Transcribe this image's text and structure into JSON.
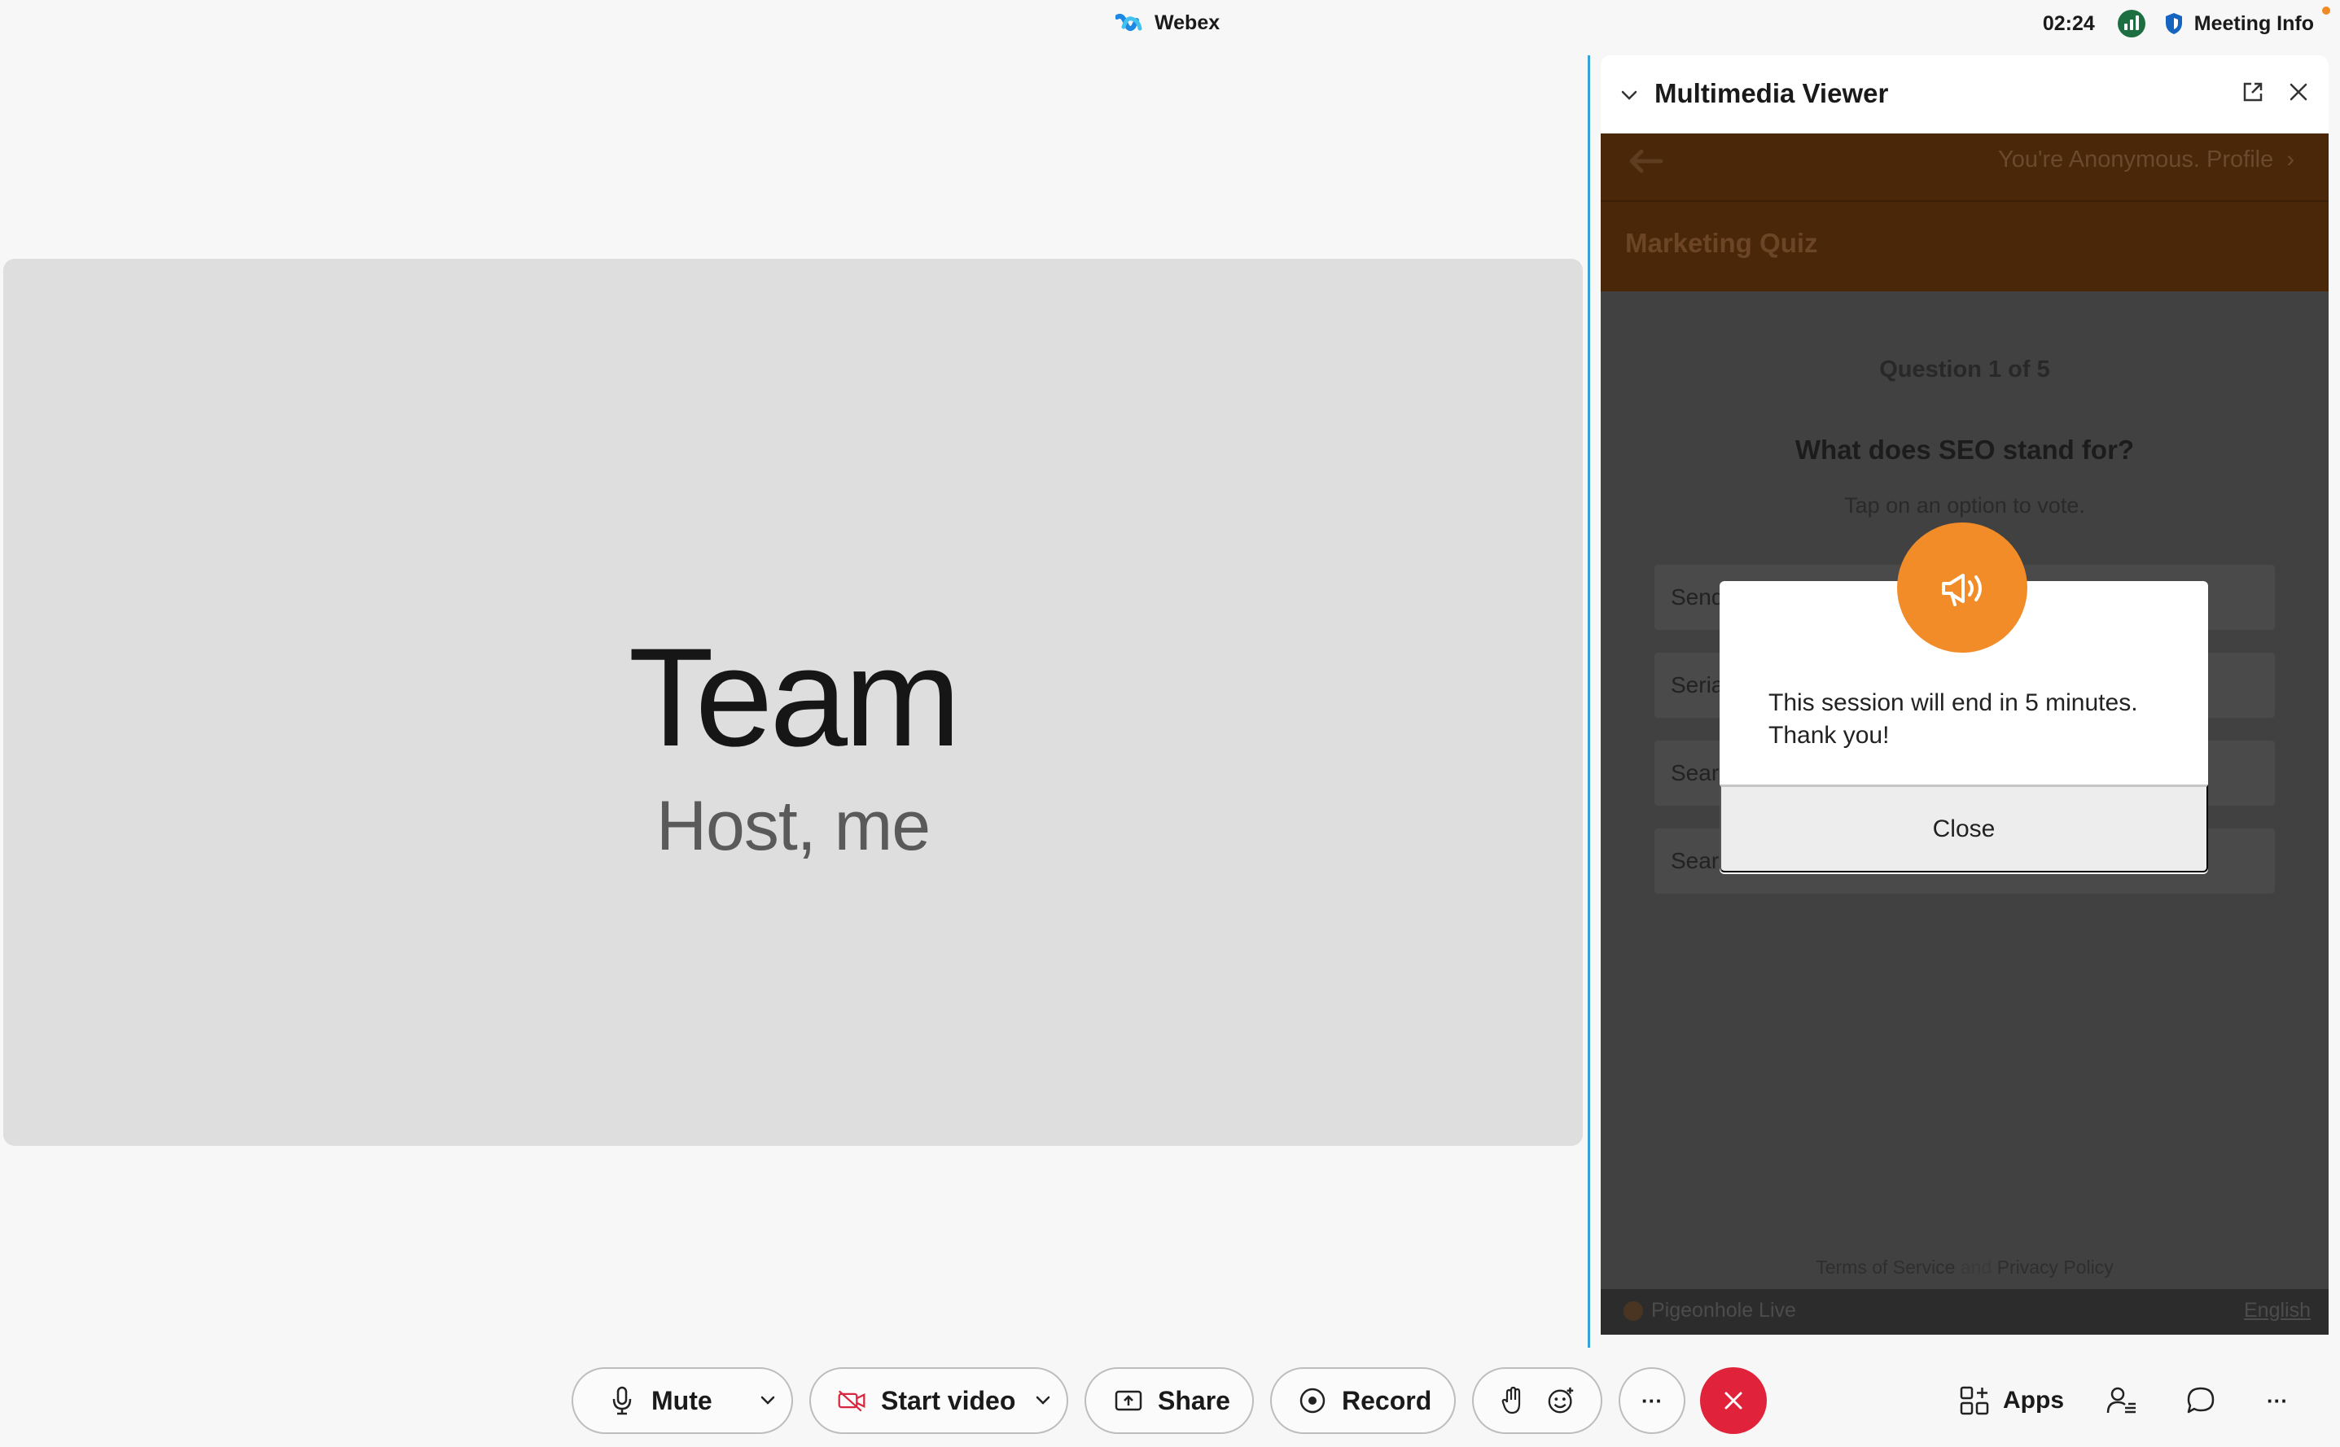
{
  "titlebar": {
    "app_name": "Webex",
    "clock": "02:24",
    "meeting_info": "Meeting Info",
    "notification_color": "#f08a24"
  },
  "stage": {
    "name": "Team",
    "subtitle": "Host, me"
  },
  "panel": {
    "title": "Multimedia Viewer",
    "icons": [
      "chevron-down-icon",
      "popout-icon",
      "close-icon"
    ]
  },
  "viewer": {
    "account_text": "You're Anonymous. Profile",
    "quiz_title": "Marketing Quiz",
    "question_number": "Question 1 of 5",
    "question": "What does SEO stand for?",
    "hint": "Tap on an option to vote.",
    "options": [
      "Send",
      "Seria",
      "Sear",
      "Sear"
    ],
    "footer_terms": "Terms of Service",
    "footer_and": "and",
    "footer_privacy": "Privacy Policy",
    "brand": "Pigeonhole Live",
    "language": "English",
    "accent_color": "#f28c28"
  },
  "modal": {
    "message": "This session will end in 5 minutes. Thank you!",
    "close_label": "Close"
  },
  "toolbar": {
    "mute": "Mute",
    "start_video": "Start video",
    "share": "Share",
    "record": "Record",
    "more": "···",
    "apps": "Apps",
    "end_color": "#e0233a"
  }
}
